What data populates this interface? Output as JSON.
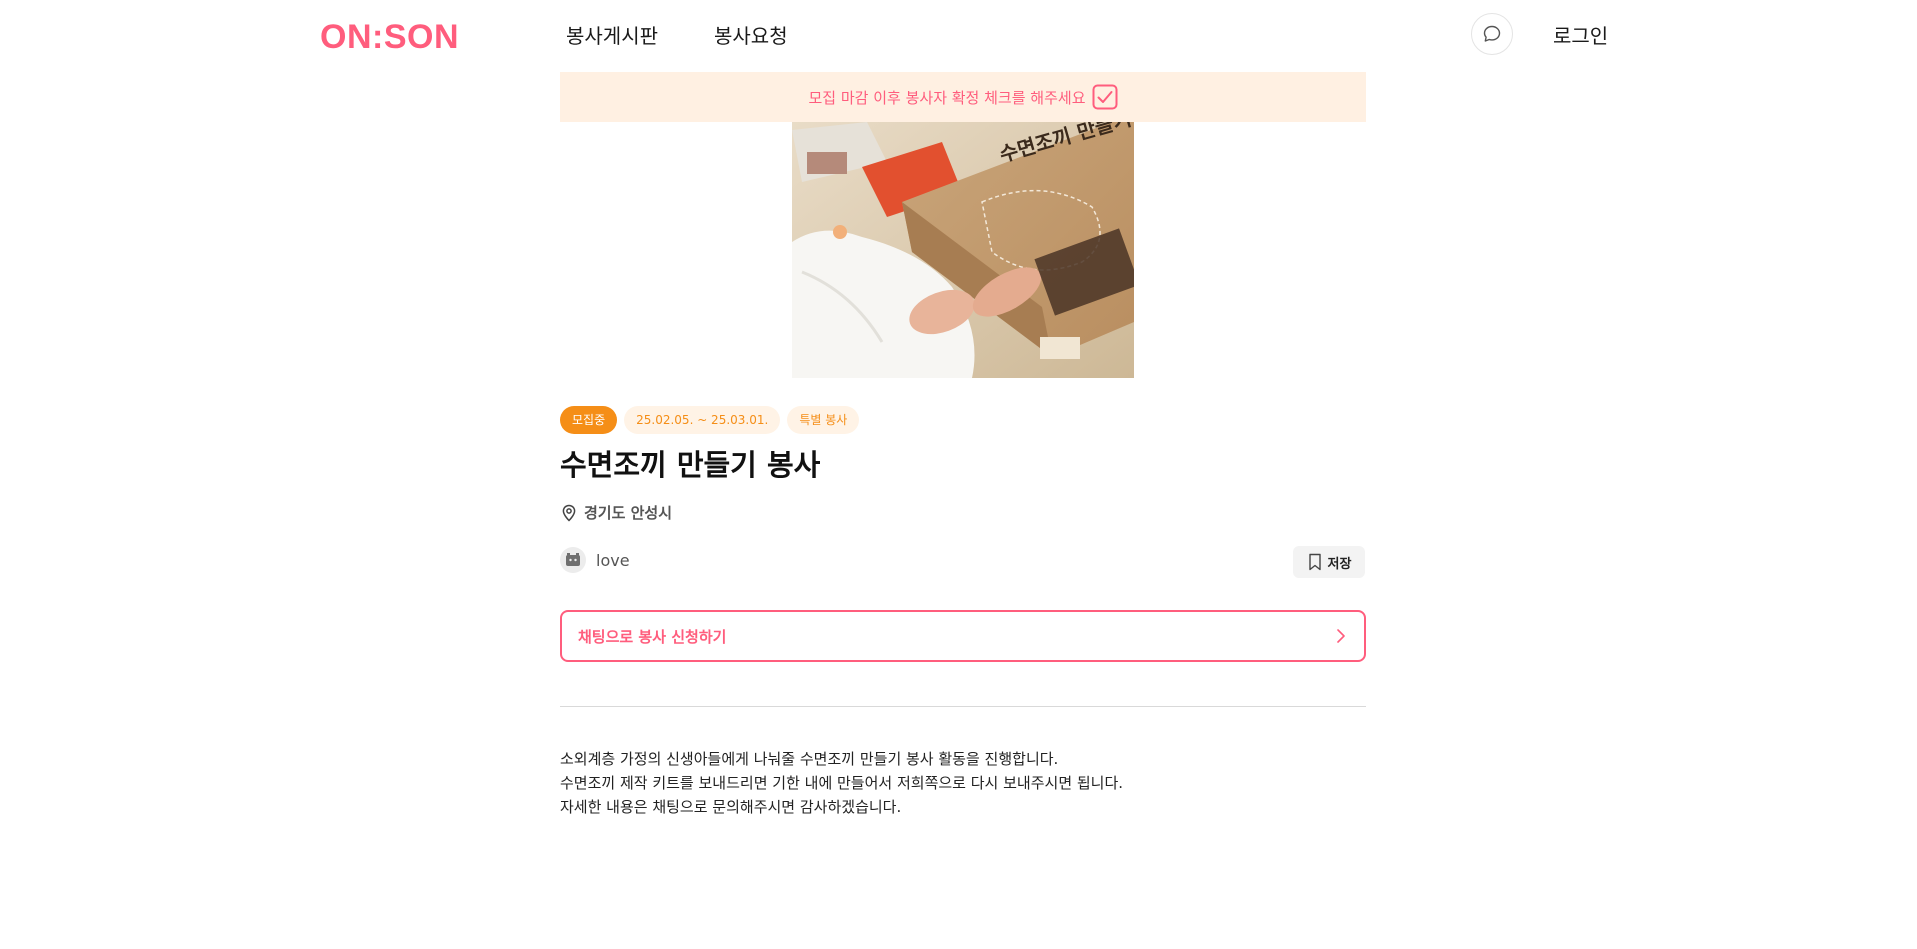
{
  "header": {
    "logo": "ON:SON",
    "nav": [
      {
        "label": "봉사게시판"
      },
      {
        "label": "봉사요청"
      }
    ],
    "chat_icon": "chat-bubble-icon",
    "login_label": "로그인"
  },
  "notice": {
    "text": "모집 마감 이후 봉사자 확정 체크를 해주세요",
    "icon": "checkbox-check-icon"
  },
  "post": {
    "image_alt_icon": "volunteer-photo",
    "badges": {
      "status": "모집중",
      "period": "25.02.05. ~ 25.03.01.",
      "category": "특별 봉사"
    },
    "title": "수면조끼 만들기 봉사",
    "location": "경기도 안성시",
    "author": "love",
    "save_label": "저장",
    "apply_label": "채팅으로 봉사 신청하기",
    "description": [
      "소외계층 가정의 신생아들에게 나눠줄 수면조끼 만들기 봉사 활동을 진행합니다.",
      "수면조끼 제작 키트를 보내드리면 기한 내에 만들어서 저희쪽으로 다시 보내주시면 됩니다.",
      "자세한 내용은 채팅으로 문의해주시면 감사하겠습니다."
    ]
  },
  "colors": {
    "brand": "#ff5d7d",
    "accent_orange": "#f58e17",
    "notice_bg": "#fff0e2"
  }
}
